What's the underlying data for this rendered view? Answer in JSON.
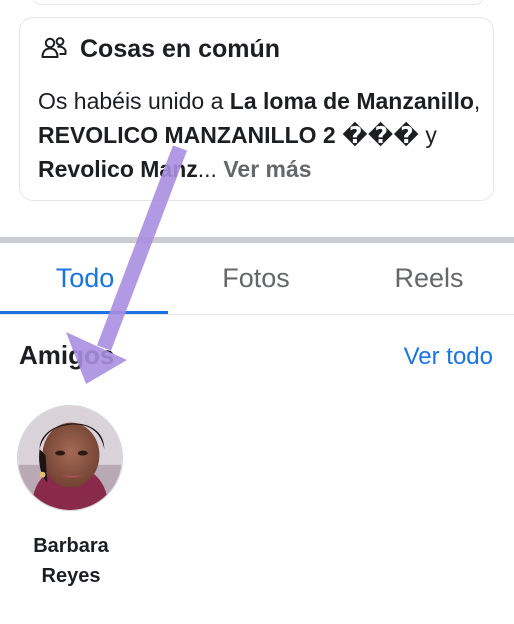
{
  "common": {
    "title": "Cosas en común",
    "icon": "people-icon",
    "text_prefix": "Os habéis unido a ",
    "group_1": "La loma de Manzanillo",
    "separator": ", ",
    "group_2": "REVOLICO MANZANILLO 2 ���",
    "conjunction": " y ",
    "group_3": "Revolico Manz",
    "ellipsis": "...",
    "see_more": "Ver más"
  },
  "tabs": [
    {
      "label": "Todo",
      "active": true
    },
    {
      "label": "Fotos",
      "active": false
    },
    {
      "label": "Reels",
      "active": false
    }
  ],
  "friends": {
    "title": "Amigos",
    "see_all": "Ver todo",
    "items": [
      {
        "name": "Barbara Reyes",
        "avatar": "profile-photo"
      }
    ]
  },
  "colors": {
    "accent": "#1b74e4",
    "text": "#1c1e21",
    "muted": "#65676b",
    "annotation_arrow": "#a98ee0"
  }
}
